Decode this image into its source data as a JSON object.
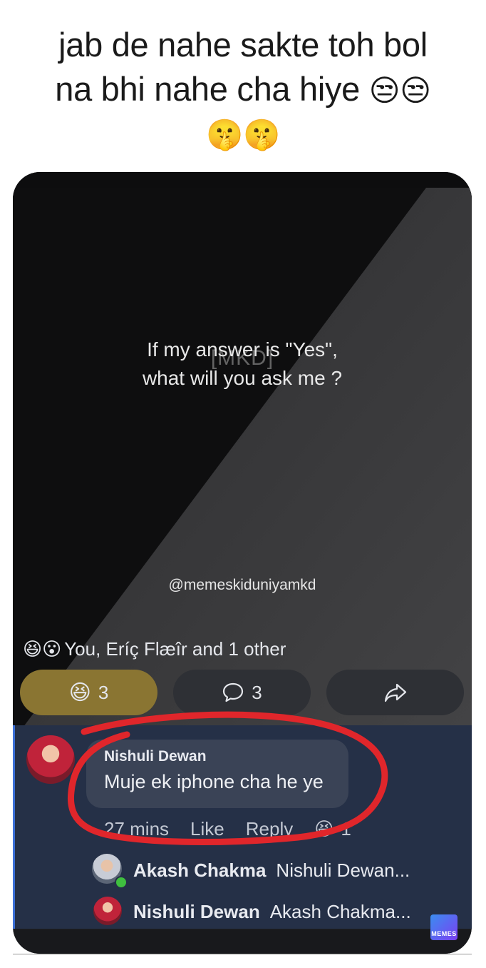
{
  "caption": {
    "line1": "jab de nahe sakte toh bol",
    "line2": "na bhi nahe cha hiye",
    "line2_emojis": "😒😒",
    "line3_emojis": "🤫🤫"
  },
  "post": {
    "quote_line1": "If my answer is \"Yes\",",
    "quote_line2": "what will you ask me ?",
    "watermark": "[MKD]",
    "handle": "@memeskiduniyamkd"
  },
  "reactions": {
    "emojis": "😆😮",
    "summary": "You, Eríç Flæîr and 1 other"
  },
  "actions": {
    "react_icon": "😆",
    "react_count": "3",
    "comment_icon": "🗨",
    "comment_count": "3",
    "share_icon": "⇨"
  },
  "comment": {
    "author": "Nishuli Dewan",
    "text": "Muje ek iphone cha he ye",
    "time": "27 mins",
    "like": "Like",
    "reply": "Reply",
    "reaction_icon": "😆",
    "reaction_count": "1"
  },
  "replies": [
    {
      "author": "Akash Chakma",
      "preview": "Nishuli Dewan..."
    },
    {
      "author": "Nishuli Dewan",
      "preview": "Akash Chakma..."
    }
  ],
  "logo_text": "MEMES",
  "colors": {
    "caption_text": "#1a1a1a",
    "active_reaction": "#8a7532",
    "comment_bg": "#253047",
    "red_annotation": "#e0262b"
  }
}
